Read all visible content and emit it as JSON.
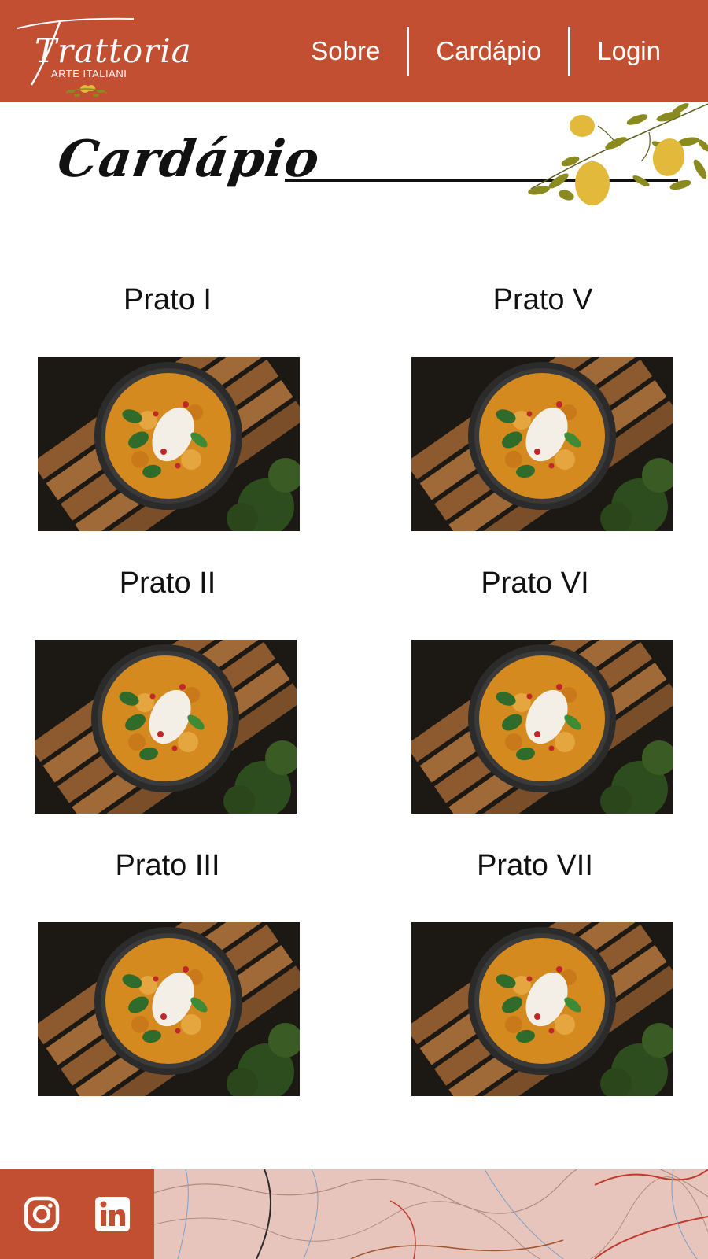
{
  "brand": {
    "name": "Trattoria",
    "tagline": "ARTE ITALIANI"
  },
  "nav": {
    "items": [
      {
        "label": "Sobre"
      },
      {
        "label": "Cardápio"
      },
      {
        "label": "Login"
      }
    ]
  },
  "page": {
    "title": "Cardápio"
  },
  "menu": {
    "dishes": [
      {
        "name": "Prato I"
      },
      {
        "name": "Prato V"
      },
      {
        "name": "Prato II"
      },
      {
        "name": "Prato VI"
      },
      {
        "name": "Prato III"
      },
      {
        "name": "Prato VII"
      }
    ]
  },
  "footer": {
    "social": [
      {
        "icon": "instagram-icon"
      },
      {
        "icon": "linkedin-icon"
      }
    ]
  },
  "colors": {
    "brand": "#c24f31",
    "text": "#111111",
    "background": "#ffffff",
    "lemon": "#e2b93b",
    "leaf": "#8a8a1e"
  }
}
